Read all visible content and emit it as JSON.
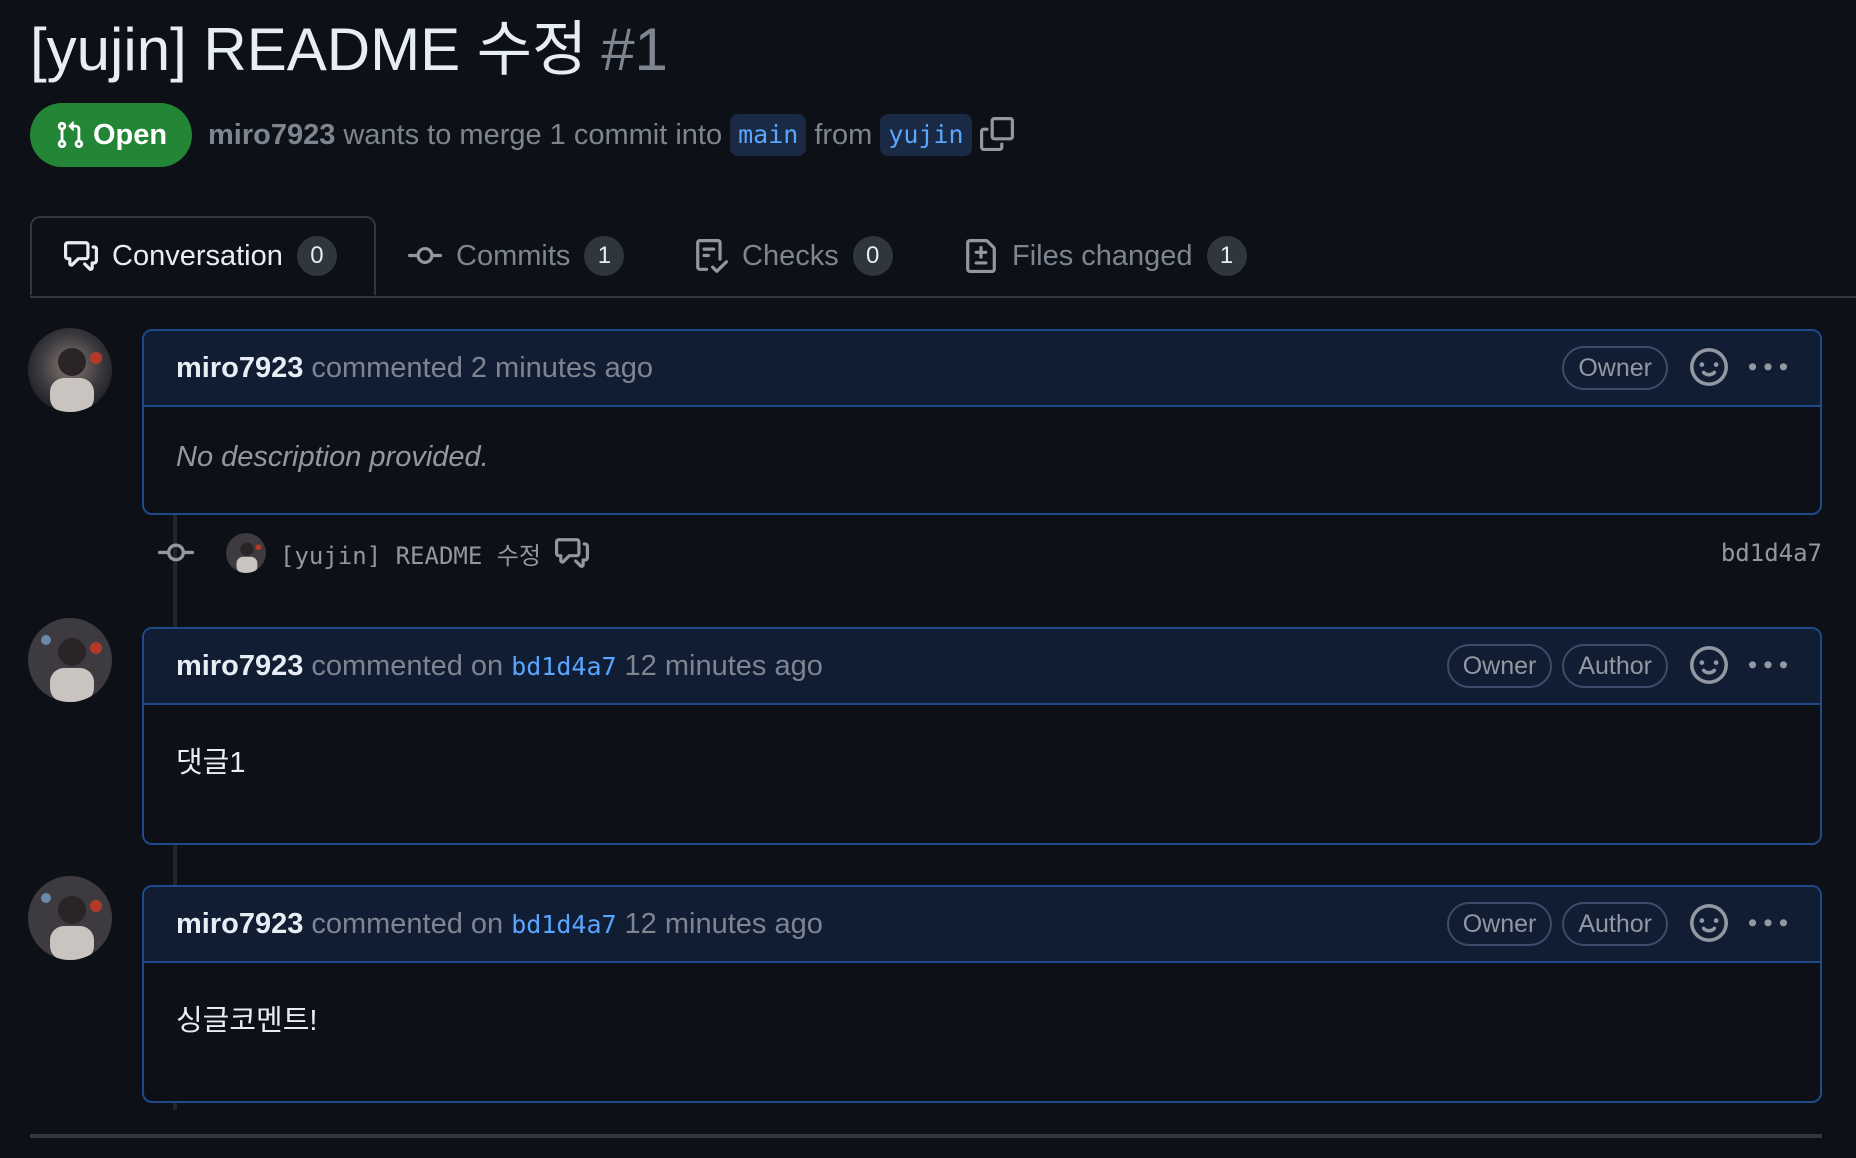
{
  "pr": {
    "title": "[yujin] README 수정",
    "number": "#1",
    "status": "Open",
    "author": "miro7923",
    "merge_text": "wants to merge 1 commit into",
    "base_branch": "main",
    "from_text": "from",
    "head_branch": "yujin"
  },
  "tabs": [
    {
      "label": "Conversation",
      "count": "0",
      "icon": "comment-discussion-icon"
    },
    {
      "label": "Commits",
      "count": "1",
      "icon": "git-commit-icon"
    },
    {
      "label": "Checks",
      "count": "0",
      "icon": "checklist-icon"
    },
    {
      "label": "Files changed",
      "count": "1",
      "icon": "file-diff-icon"
    }
  ],
  "comments": [
    {
      "author": "miro7923",
      "action": "commented",
      "on": "",
      "sha": "",
      "time": "2 minutes ago",
      "labels": [
        "Owner"
      ],
      "body": "No description provided."
    },
    {
      "author": "miro7923",
      "action": "commented on",
      "sha": "bd1d4a7",
      "time": "12 minutes ago",
      "labels": [
        "Owner",
        "Author"
      ],
      "body": "댓글1"
    },
    {
      "author": "miro7923",
      "action": "commented on",
      "sha": "bd1d4a7",
      "time": "12 minutes ago",
      "labels": [
        "Owner",
        "Author"
      ],
      "body": "싱글코멘트!"
    }
  ],
  "commit": {
    "message": "[yujin] README 수정",
    "sha": "bd1d4a7"
  },
  "colors": {
    "background": "#0d1117",
    "open_badge": "#238636",
    "link": "#58a6ff",
    "comment_border": "#1f4a8a",
    "comment_header_bg": "#111d33"
  }
}
